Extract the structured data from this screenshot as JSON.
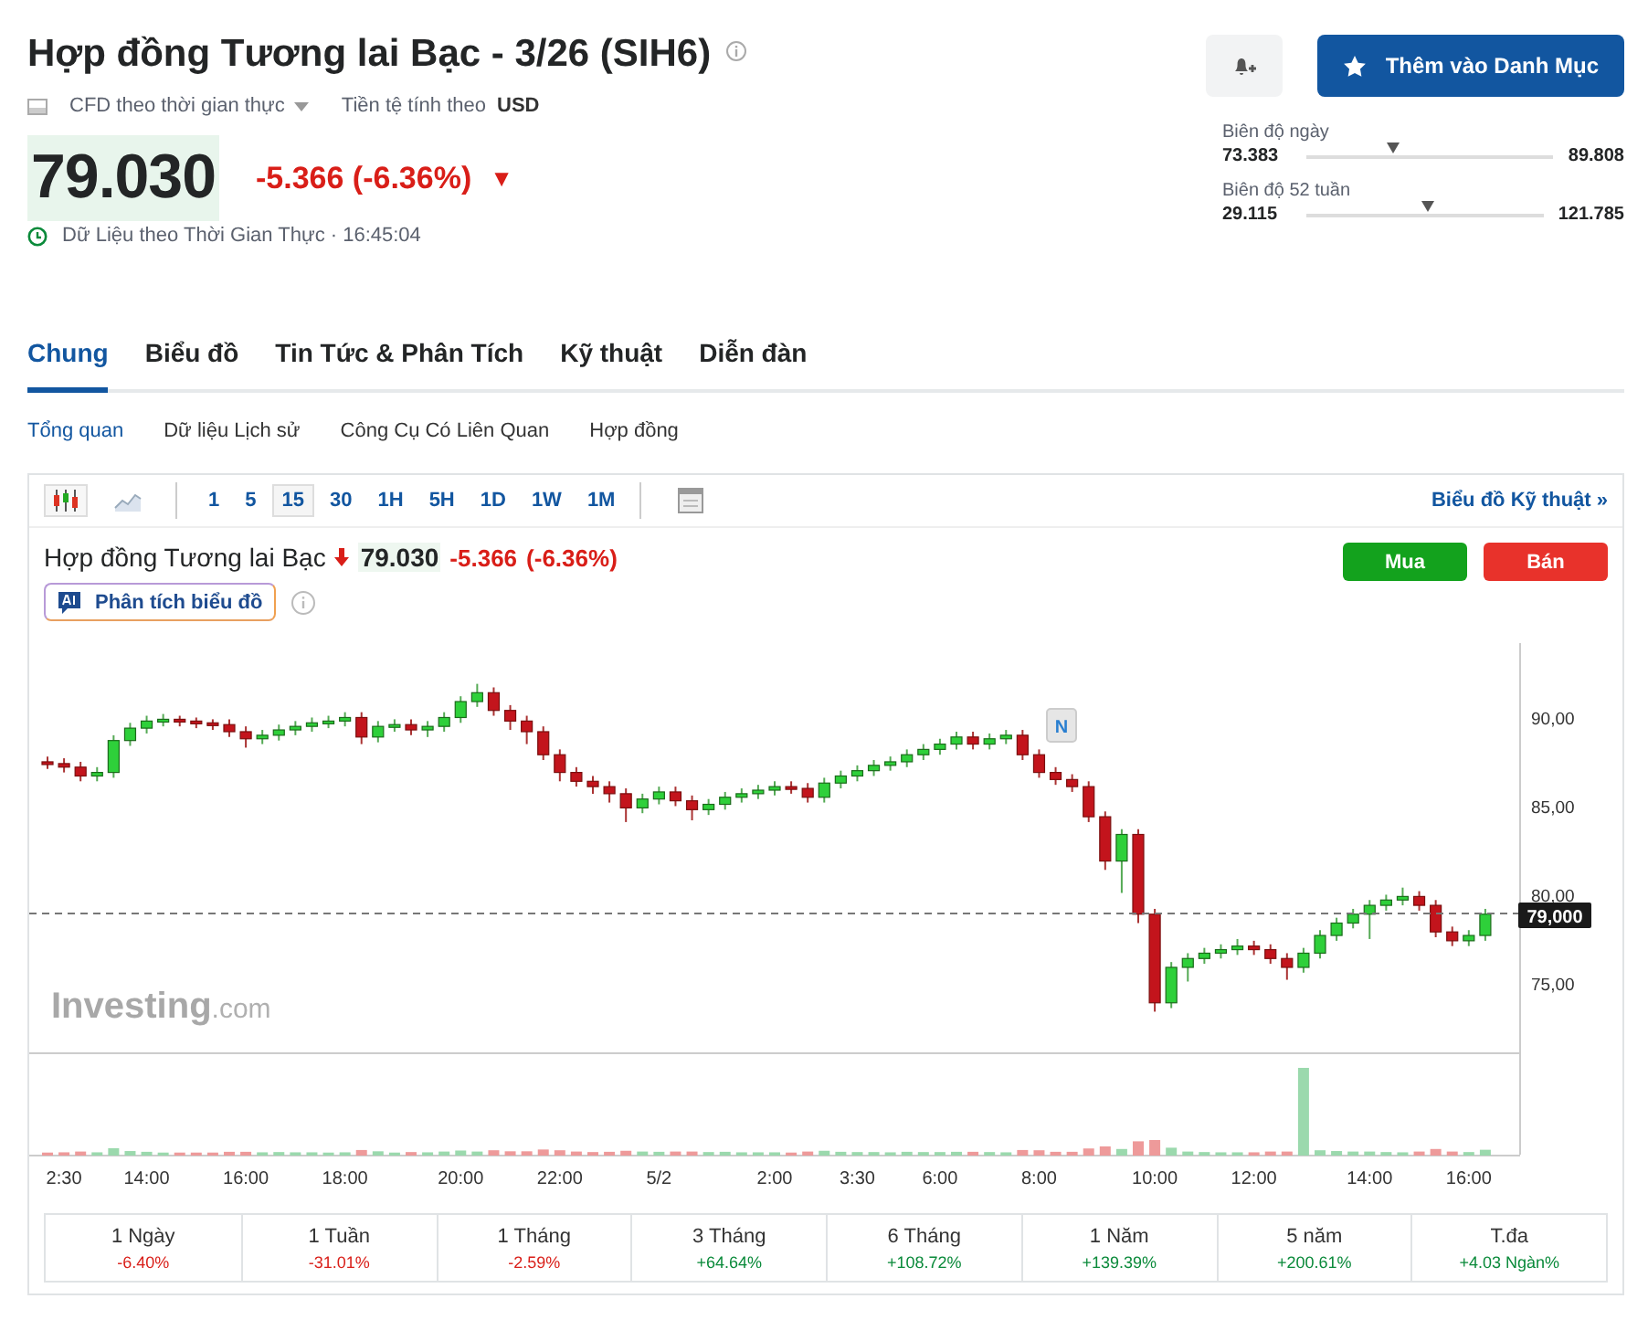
{
  "header": {
    "title": "Hợp đồng Tương lai Bạc - 3/26 (SIH6)",
    "data_type": "CFD theo thời gian thực",
    "currency_label": "Tiền tệ tính theo",
    "currency": "USD",
    "add_button": "Thêm vào Danh Mục"
  },
  "quote": {
    "price": "79.030",
    "change": "-5.366 (-6.36%)",
    "color": "#d91e18",
    "arrow": "▼",
    "timestamp": "Dữ Liệu theo Thời Gian Thực · 16:45:04"
  },
  "ranges": [
    {
      "label": "Biên độ ngày",
      "low": "73.383",
      "high": "89.808",
      "level": 0.35
    },
    {
      "label": "Biên độ 52 tuần",
      "low": "29.115",
      "high": "121.785",
      "level": 0.51
    }
  ],
  "tabs": [
    {
      "label": "Chung",
      "selected": true
    },
    {
      "label": "Biểu đồ",
      "selected": false
    },
    {
      "label": "Tin Tức & Phân Tích",
      "selected": false
    },
    {
      "label": "Kỹ thuật",
      "selected": false
    },
    {
      "label": "Diễn đàn",
      "selected": false
    }
  ],
  "subtabs": [
    {
      "label": "Tổng quan",
      "selected": true
    },
    {
      "label": "Dữ liệu Lịch sử",
      "selected": false
    },
    {
      "label": "Công Cụ Có Liên Quan",
      "selected": false
    },
    {
      "label": "Hợp đồng",
      "selected": false
    }
  ],
  "toolbar": {
    "intervals": [
      {
        "label": "1",
        "selected": false
      },
      {
        "label": "5",
        "selected": false
      },
      {
        "label": "15",
        "selected": true
      },
      {
        "label": "30",
        "selected": false
      },
      {
        "label": "1H",
        "selected": false
      },
      {
        "label": "5H",
        "selected": false
      },
      {
        "label": "1D",
        "selected": false
      },
      {
        "label": "1W",
        "selected": false
      },
      {
        "label": "1M",
        "selected": false
      }
    ],
    "link": "Biểu đồ Kỹ thuật »"
  },
  "chart_header": {
    "name": "Hợp đồng Tương lai Bạc",
    "price": "79.030",
    "change": "-5.366",
    "percent": "(-6.36%)",
    "ai_button": "Phân tích biểu đồ",
    "buy": "Mua",
    "sell": "Bán"
  },
  "chart": {
    "last_label": "79,000",
    "news_marker": "N",
    "brand": [
      "Investing",
      ".com"
    ],
    "chart_data": {
      "type": "candlestick",
      "ylim": [
        65.43,
        94.3
      ],
      "yticks": [
        {
          "value": 90,
          "label": "90,00"
        },
        {
          "value": 85,
          "label": "85,00"
        },
        {
          "value": 80,
          "label": "80,00"
        },
        {
          "value": 75,
          "label": "75,00"
        }
      ],
      "categories": [
        null,
        "2:30",
        null,
        null,
        null,
        null,
        "14:00",
        null,
        null,
        null,
        null,
        null,
        "16:00",
        null,
        null,
        null,
        null,
        null,
        "18:00",
        null,
        null,
        null,
        null,
        null,
        null,
        "20:00",
        null,
        null,
        null,
        null,
        null,
        "22:00",
        null,
        null,
        null,
        null,
        null,
        "5/2",
        null,
        null,
        null,
        null,
        null,
        null,
        "2:00",
        null,
        null,
        null,
        null,
        "3:30",
        null,
        null,
        null,
        null,
        "6:00",
        null,
        null,
        null,
        null,
        null,
        "8:00",
        null,
        null,
        null,
        null,
        null,
        null,
        "10:00",
        null,
        null,
        null,
        null,
        null,
        "12:00",
        null,
        null,
        null,
        null,
        null,
        null,
        "14:00",
        null,
        null,
        null,
        null,
        null,
        "16:00",
        null
      ],
      "ohlc": [
        [
          87.6,
          87.9,
          87.2,
          87.5
        ],
        [
          87.5,
          87.8,
          87.0,
          87.3
        ],
        [
          87.3,
          87.6,
          86.5,
          86.8
        ],
        [
          86.8,
          87.3,
          86.5,
          87.0
        ],
        [
          87.0,
          89.1,
          86.7,
          88.8
        ],
        [
          88.8,
          89.8,
          88.5,
          89.5
        ],
        [
          89.5,
          90.2,
          89.2,
          89.9
        ],
        [
          89.9,
          90.3,
          89.6,
          90.0
        ],
        [
          90.0,
          90.2,
          89.6,
          89.9
        ],
        [
          89.9,
          90.1,
          89.5,
          89.8
        ],
        [
          89.8,
          90.0,
          89.4,
          89.7
        ],
        [
          89.7,
          90.0,
          89.0,
          89.3
        ],
        [
          89.3,
          89.6,
          88.4,
          88.9
        ],
        [
          88.9,
          89.4,
          88.6,
          89.1
        ],
        [
          89.1,
          89.7,
          88.8,
          89.4
        ],
        [
          89.4,
          89.9,
          89.1,
          89.6
        ],
        [
          89.6,
          90.1,
          89.3,
          89.8
        ],
        [
          89.8,
          90.2,
          89.5,
          89.9
        ],
        [
          89.9,
          90.4,
          89.6,
          90.1
        ],
        [
          90.1,
          90.4,
          88.6,
          89.0
        ],
        [
          89.0,
          89.9,
          88.7,
          89.6
        ],
        [
          89.6,
          90.0,
          89.3,
          89.7
        ],
        [
          89.7,
          90.0,
          89.1,
          89.4
        ],
        [
          89.4,
          89.9,
          89.0,
          89.6
        ],
        [
          89.6,
          90.4,
          89.3,
          90.1
        ],
        [
          90.1,
          91.3,
          89.8,
          91.0
        ],
        [
          91.0,
          92.0,
          90.7,
          91.5
        ],
        [
          91.5,
          91.8,
          90.2,
          90.5
        ],
        [
          90.5,
          90.8,
          89.4,
          89.9
        ],
        [
          89.9,
          90.2,
          88.6,
          89.3
        ],
        [
          89.3,
          89.6,
          87.7,
          88.0
        ],
        [
          88.0,
          88.3,
          86.5,
          87.0
        ],
        [
          87.0,
          87.3,
          86.2,
          86.5
        ],
        [
          86.5,
          86.8,
          85.8,
          86.2
        ],
        [
          86.2,
          86.5,
          85.3,
          85.8
        ],
        [
          85.8,
          86.1,
          84.2,
          85.0
        ],
        [
          85.0,
          85.8,
          84.7,
          85.5
        ],
        [
          85.5,
          86.2,
          85.2,
          85.9
        ],
        [
          85.9,
          86.2,
          85.1,
          85.4
        ],
        [
          85.4,
          85.7,
          84.3,
          84.9
        ],
        [
          84.9,
          85.5,
          84.6,
          85.2
        ],
        [
          85.2,
          85.9,
          84.9,
          85.6
        ],
        [
          85.6,
          86.1,
          85.3,
          85.8
        ],
        [
          85.8,
          86.3,
          85.5,
          86.0
        ],
        [
          86.0,
          86.5,
          85.7,
          86.2
        ],
        [
          86.2,
          86.5,
          85.8,
          86.1
        ],
        [
          86.1,
          86.4,
          85.3,
          85.6
        ],
        [
          85.6,
          86.7,
          85.3,
          86.4
        ],
        [
          86.4,
          87.1,
          86.1,
          86.8
        ],
        [
          86.8,
          87.4,
          86.5,
          87.1
        ],
        [
          87.1,
          87.7,
          86.8,
          87.4
        ],
        [
          87.4,
          87.9,
          87.1,
          87.6
        ],
        [
          87.6,
          88.3,
          87.3,
          88.0
        ],
        [
          88.0,
          88.6,
          87.7,
          88.3
        ],
        [
          88.3,
          88.9,
          88.0,
          88.6
        ],
        [
          88.6,
          89.3,
          88.3,
          89.0
        ],
        [
          89.0,
          89.3,
          88.3,
          88.6
        ],
        [
          88.6,
          89.2,
          88.3,
          88.9
        ],
        [
          88.9,
          89.4,
          88.6,
          89.1
        ],
        [
          89.1,
          89.4,
          87.7,
          88.0
        ],
        [
          88.0,
          88.3,
          86.7,
          87.0
        ],
        [
          87.0,
          87.3,
          86.3,
          86.6
        ],
        [
          86.6,
          86.9,
          85.9,
          86.2
        ],
        [
          86.2,
          86.5,
          84.2,
          84.5
        ],
        [
          84.5,
          84.8,
          81.5,
          82.0
        ],
        [
          82.0,
          83.8,
          80.2,
          83.5
        ],
        [
          83.5,
          83.8,
          78.5,
          79.0
        ],
        [
          79.0,
          79.3,
          73.5,
          74.0
        ],
        [
          74.0,
          76.3,
          73.7,
          76.0
        ],
        [
          76.0,
          76.8,
          75.2,
          76.5
        ],
        [
          76.5,
          77.1,
          76.2,
          76.8
        ],
        [
          76.8,
          77.3,
          76.5,
          77.0
        ],
        [
          77.0,
          77.6,
          76.7,
          77.2
        ],
        [
          77.2,
          77.5,
          76.7,
          77.0
        ],
        [
          77.0,
          77.3,
          76.2,
          76.5
        ],
        [
          76.5,
          76.8,
          75.3,
          76.0
        ],
        [
          76.0,
          77.1,
          75.7,
          76.8
        ],
        [
          76.8,
          78.1,
          76.5,
          77.8
        ],
        [
          77.8,
          78.8,
          77.5,
          78.5
        ],
        [
          78.5,
          79.3,
          78.2,
          79.0
        ],
        [
          79.0,
          79.8,
          77.6,
          79.5
        ],
        [
          79.5,
          80.1,
          79.2,
          79.8
        ],
        [
          79.8,
          80.5,
          79.5,
          80.0
        ],
        [
          80.0,
          80.3,
          79.2,
          79.5
        ],
        [
          79.5,
          79.8,
          77.7,
          78.0
        ],
        [
          78.0,
          78.3,
          77.2,
          77.5
        ],
        [
          77.5,
          78.1,
          77.2,
          77.8
        ],
        [
          77.8,
          79.3,
          77.5,
          79.0
        ]
      ]
    }
  },
  "periods": [
    {
      "label": "1 Ngày",
      "value": "-6.40%",
      "color": "#d91e18"
    },
    {
      "label": "1 Tuần",
      "value": "-31.01%",
      "color": "#d91e18"
    },
    {
      "label": "1 Tháng",
      "value": "-2.59%",
      "color": "#d91e18"
    },
    {
      "label": "3 Tháng",
      "value": "+64.64%",
      "color": "#0a8a3a"
    },
    {
      "label": "6 Tháng",
      "value": "+108.72%",
      "color": "#0a8a3a"
    },
    {
      "label": "1 Năm",
      "value": "+139.39%",
      "color": "#0a8a3a"
    },
    {
      "label": "5 năm",
      "value": "+200.61%",
      "color": "#0a8a3a"
    },
    {
      "label": "T.đa",
      "value": "+4.03 Ngàn%",
      "color": "#0a8a3a"
    }
  ]
}
